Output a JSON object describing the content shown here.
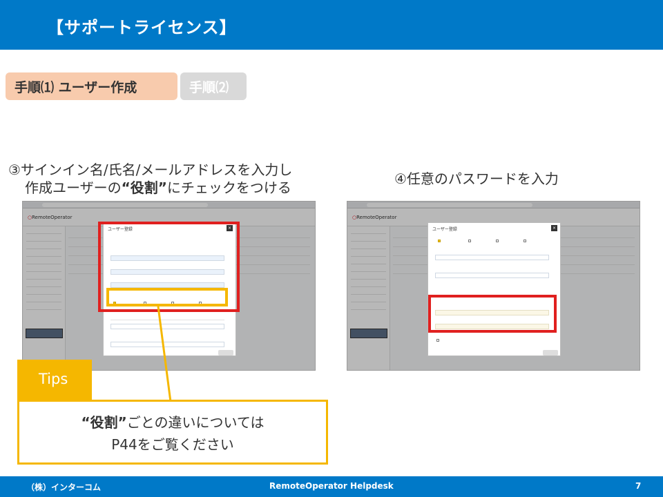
{
  "header": {
    "title": "【サポートライセンス】"
  },
  "steps": [
    {
      "label": "手順⑴ ユーザー作成",
      "active": true
    },
    {
      "label": "手順⑵",
      "active": false
    }
  ],
  "instruction3": {
    "line1": "③サインイン名/氏名/メールアドレスを入力し",
    "line2_pre": "作成ユーザーの",
    "line2_bold": "“役割”",
    "line2_post": "にチェックをつける"
  },
  "instruction4": {
    "text": "④任意のパスワードを入力"
  },
  "tips": {
    "tag": "Tips",
    "line1_bold": "“役割”",
    "line1_rest": "ごとの違いについては",
    "line2": "P44をご覧ください"
  },
  "screenshot_left": {
    "logo_red": "○",
    "logo_text": "RemoteOperator",
    "dialog_title": "ユーザー登録",
    "close_label": "×"
  },
  "screenshot_right": {
    "logo_red": "○",
    "logo_text": "RemoteOperator",
    "dialog_title": "ユーザー登録",
    "close_label": "×"
  },
  "footer": {
    "company": "（株）インターコム",
    "product": "RemoteOperator  Helpdesk",
    "page": "7"
  },
  "colors": {
    "brand_blue": "#0079c8",
    "step_active": "#f8cbad",
    "step_inactive": "#d9d9d9",
    "highlight_red": "#e0201f",
    "tips_yellow": "#f5b700"
  }
}
